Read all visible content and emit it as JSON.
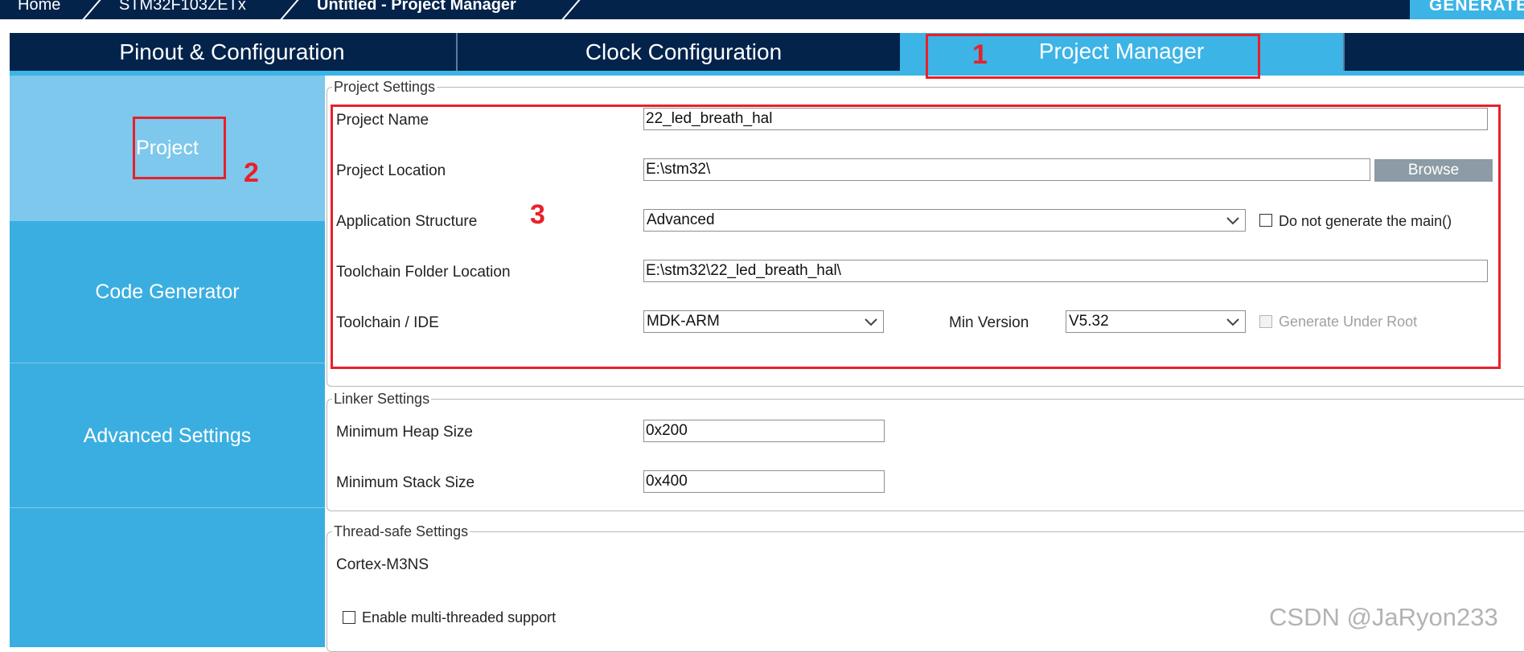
{
  "breadcrumb": {
    "home": "Home",
    "mcu": "STM32F103ZETx",
    "project": "Untitled - Project Manager",
    "generate_label": "GENERATE CODE"
  },
  "tabs": {
    "pinout": "Pinout & Configuration",
    "clock": "Clock Configuration",
    "project_manager": "Project Manager"
  },
  "sidebar": {
    "items": [
      {
        "label": "Project"
      },
      {
        "label": "Code Generator"
      },
      {
        "label": "Advanced Settings"
      }
    ]
  },
  "project_settings": {
    "legend": "Project Settings",
    "project_name_label": "Project Name",
    "project_name_value": "22_led_breath_hal",
    "project_location_label": "Project Location",
    "project_location_value": "E:\\stm32\\",
    "browse_label": "Browse",
    "app_structure_label": "Application Structure",
    "app_structure_value": "Advanced",
    "no_main_label": "Do not generate the main()",
    "toolchain_folder_label": "Toolchain Folder Location",
    "toolchain_folder_value": "E:\\stm32\\22_led_breath_hal\\",
    "toolchain_ide_label": "Toolchain / IDE",
    "toolchain_ide_value": "MDK-ARM",
    "min_version_label": "Min Version",
    "min_version_value": "V5.32",
    "generate_under_root_label": "Generate Under Root"
  },
  "linker_settings": {
    "legend": "Linker Settings",
    "heap_label": "Minimum Heap Size",
    "heap_value": "0x200",
    "stack_label": "Minimum Stack Size",
    "stack_value": "0x400"
  },
  "thread_settings": {
    "legend": "Thread-safe Settings",
    "core": "Cortex-M3NS",
    "multithread_label": "Enable multi-threaded support"
  },
  "annotations": {
    "n1": "1",
    "n2": "2",
    "n3": "3",
    "color": "#e8202a"
  },
  "watermark": "CSDN @JaRyon233",
  "colors": {
    "navy": "#03234b",
    "accent": "#3cb4e6",
    "sidebar": "#3aaee0",
    "sidebar_selected": "#7dc8ec"
  }
}
